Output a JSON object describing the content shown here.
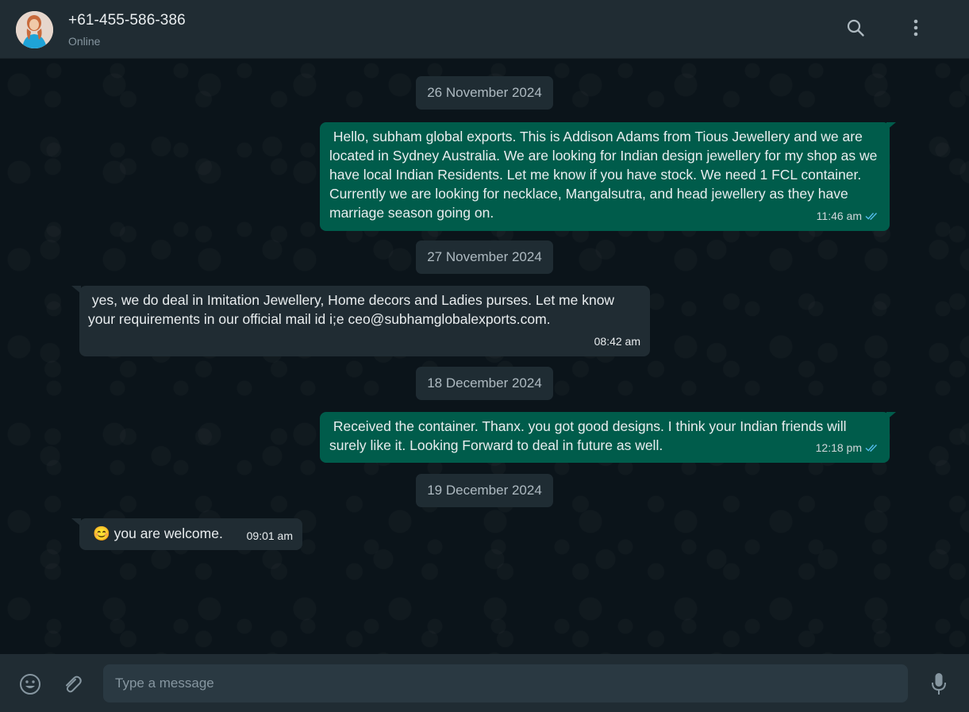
{
  "header": {
    "contact_name": "+61-455-586-386",
    "status": "Online"
  },
  "dates": [
    "26 November 2024",
    "27 November 2024",
    "18 December 2024",
    "19 December 2024"
  ],
  "messages": [
    {
      "direction": "outgoing",
      "text": " Hello, subham global exports. This is Addison Adams from Tious Jewellery and we are located in Sydney Australia. We are looking for Indian design jewellery for my shop as we have local Indian Residents. Let me know if you have stock. We need 1 FCL container. Currently we are looking for necklace, Mangalsutra, and head jewellery as they have marriage season going on.",
      "time": "11:46 am",
      "read": true
    },
    {
      "direction": "incoming",
      "text": " yes, we do deal in Imitation Jewellery, Home decors and Ladies purses. Let me know your requirements in our official mail id i;e ceo@subhamglobalexports.com.",
      "time": "08:42 am"
    },
    {
      "direction": "outgoing",
      "text": " Received the container. Thanx. you got good designs. I think your Indian friends will surely like it. Looking Forward to deal in future as well.",
      "time": "12:18 pm",
      "read": true
    },
    {
      "direction": "incoming",
      "emoji": "😊",
      "text": "you are welcome.",
      "time": "09:01 am"
    }
  ],
  "footer": {
    "placeholder": "Type a message"
  },
  "icons": {
    "search": "search-icon",
    "menu": "menu-icon",
    "emoji": "emoji-icon",
    "attach": "attach-icon",
    "mic": "mic-icon"
  },
  "colors": {
    "header_bg": "#202c33",
    "chat_bg": "#0b141a",
    "outgoing_bubble": "#005c4b",
    "incoming_bubble": "#202c33",
    "read_ticks": "#53bdeb"
  }
}
